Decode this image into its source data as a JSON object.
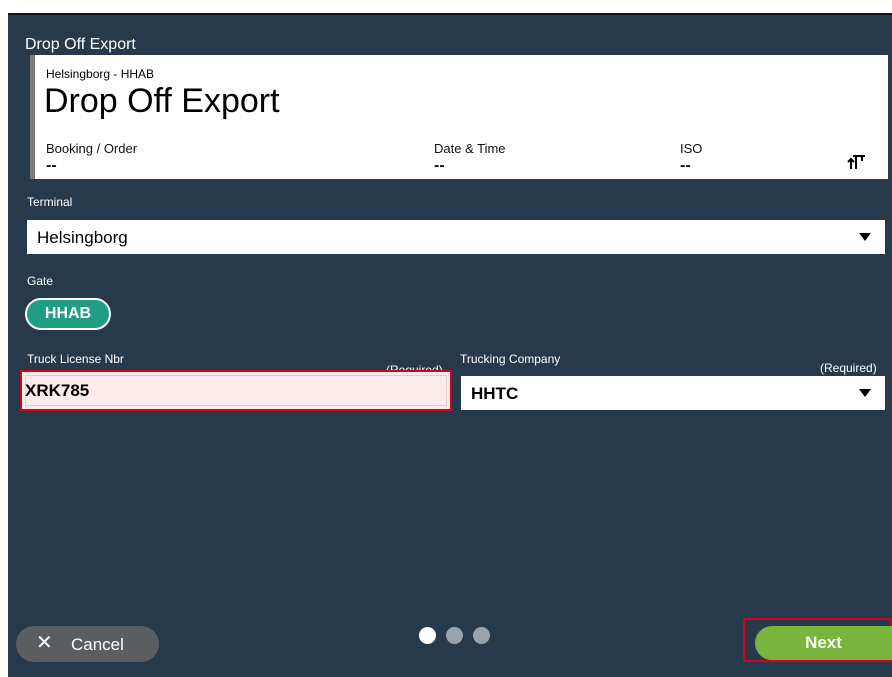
{
  "window": {
    "title": "Drop Off Export"
  },
  "header": {
    "location": "Helsingborg - HHAB",
    "title": "Drop Off Export",
    "fields": [
      {
        "label": "Booking / Order",
        "value": "--"
      },
      {
        "label": "Date & Time",
        "value": "--"
      },
      {
        "label": "ISO",
        "value": "--"
      }
    ],
    "icon": "crane-icon"
  },
  "form": {
    "terminal": {
      "label": "Terminal",
      "value": "Helsingborg"
    },
    "gate": {
      "label": "Gate",
      "value": "HHAB"
    },
    "truck_license": {
      "label": "Truck License Nbr",
      "required": "(Required)",
      "value": "XRK785"
    },
    "trucking_company": {
      "label": "Trucking Company",
      "required": "(Required)",
      "value": "HHTC"
    }
  },
  "footer": {
    "cancel_label": "Cancel",
    "cancel_icon": "close-icon",
    "next_label": "Next",
    "pager": {
      "total": 3,
      "current": 1
    }
  },
  "colors": {
    "background": "#263a4b",
    "gate_chip": "#1f9e83",
    "next_button": "#79b43d",
    "cancel_button": "#5b5e61",
    "error_border": "#d5001c"
  }
}
